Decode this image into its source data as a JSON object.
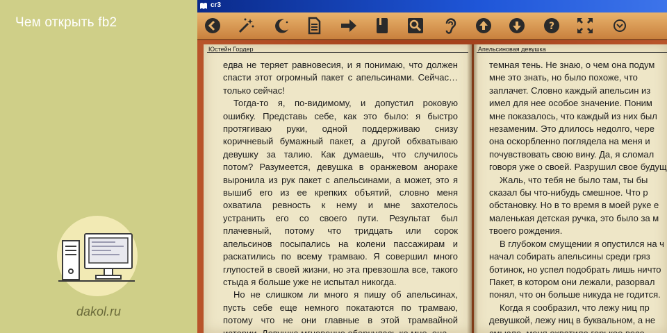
{
  "banner": {
    "title": "Чем открыть fb2",
    "site": "dakol.ru"
  },
  "window": {
    "title": "cr3"
  },
  "toolbar": {
    "icons": [
      "back-icon",
      "magic-wand-icon",
      "night-mode-icon",
      "document-icon",
      "forward-arrow-icon",
      "book-icon",
      "search-icon",
      "hearing-icon",
      "up-icon",
      "down-icon",
      "help-icon",
      "fullscreen-icon",
      "menu-icon"
    ]
  },
  "book": {
    "left_header": "Юстейн  Гордер",
    "right_header": "Апельсиновая девушка",
    "left_lines": [
      "едва не теряет равновесия, и я понимаю, что должен",
      "спасти этот огромный пакет с апельсинами. Сейчас…",
      "только сейчас!",
      "Тогда-то я, по-видимому, и допустил роковую",
      "ошибку. Представь себе, как это было: я быстро",
      "протягиваю руки, одной поддерживаю снизу",
      "коричневый бумажный пакет, а другой обхватываю",
      "девушку за талию. Как думаешь, что случилось",
      "потом? Разумеется, девушка в оранжевом анораке",
      "выронила из рук пакет с апельсинами, а может, это я",
      "вышиб его из ее крепких объятий, словно меня",
      "охватила ревность к нему и мне захотелось",
      "устранить его со своего пути. Результат был",
      "плачевный, потому что тридцать или сорок",
      "апельсинов посыпались на колени пассажирам и",
      "раскатились по всему трамваю. Я совершил много",
      "глупостей в своей жизни, но эта превзошла все, такого",
      "стыда я больше уже не испытал никогда.",
      "Но не слишком ли много я пишу об апельсинах,",
      "пусть себе еще немного покатаются по трамваю,",
      "потому что не они главные в этой трамвайной",
      "истории. Девушка мгновенно обернулась ко мне, она"
    ],
    "right_lines": [
      "темная тень. Не знаю, о чем она подум",
      "мне это знать, но было похоже, что",
      "заплачет. Словно каждый апельсин из",
      "имел для нее особое значение. Поним",
      "мне показалось, что каждый из них был",
      "незаменим. Это длилось недолго, чере",
      "она оскорбленно поглядела на меня и",
      "почувствовать свою вину. Да, я сломал",
      "говоря уже о своей. Разрушил свое будущ",
      "Жаль, что тебя не было там, ты бы",
      "сказал бы что-нибудь смешное. Что р",
      "обстановку. Но в то время в моей руке е",
      "маленькая детская ручка, это было за м",
      "твоего рождения.",
      "В глубоком смущении я опустился на ч",
      "начал собирать апельсины среди гряз",
      "ботинок, но успел подобрать лишь ничто",
      "Пакет, в котором они лежали, разорвал",
      "понял, что он больше никуда не годится.",
      "Когда я сообразил, что лежу ниц пр",
      "девушкой, лежу ниц в буквальном, а не",
      "смысле, меня охватило горькое весе"
    ]
  }
}
